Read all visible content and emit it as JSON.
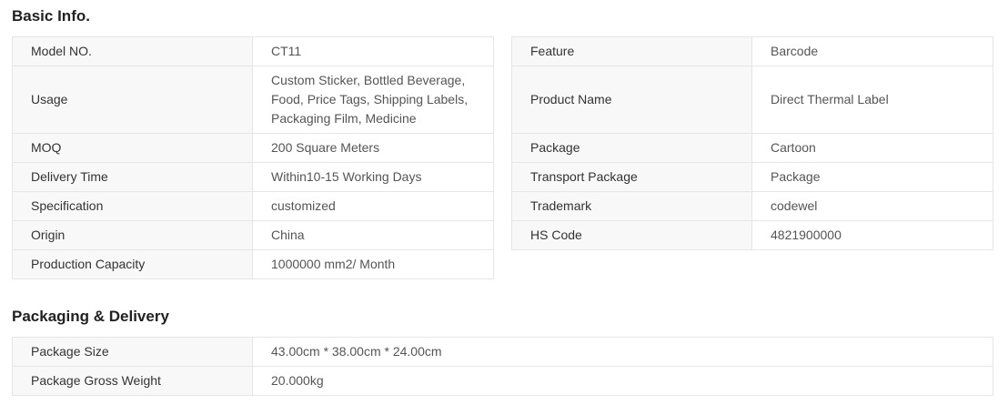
{
  "basic_info": {
    "title": "Basic Info.",
    "left_table": [
      {
        "key": "Model NO.",
        "value": "CT11"
      },
      {
        "key": "Usage",
        "value": "Custom Sticker, Bottled Beverage, Food, Price Tags, Shipping Labels, Packaging Film, Medicine"
      },
      {
        "key": "MOQ",
        "value": "200 Square Meters"
      },
      {
        "key": "Delivery Time",
        "value": "Within10-15 Working Days"
      },
      {
        "key": "Specification",
        "value": "customized"
      },
      {
        "key": "Origin",
        "value": "China"
      },
      {
        "key": "Production Capacity",
        "value": "1000000 mm2/ Month"
      }
    ],
    "right_table": [
      {
        "key": "Feature",
        "value": "Barcode"
      },
      {
        "key": "Product Name",
        "value": "Direct Thermal Label"
      },
      {
        "key": "Package",
        "value": "Cartoon"
      },
      {
        "key": "Transport Package",
        "value": "Package"
      },
      {
        "key": "Trademark",
        "value": "codewel"
      },
      {
        "key": "HS Code",
        "value": "4821900000"
      }
    ]
  },
  "packaging_delivery": {
    "title": "Packaging & Delivery",
    "rows": [
      {
        "key": "Package Size",
        "value": "43.00cm * 38.00cm * 24.00cm"
      },
      {
        "key": "Package Gross Weight",
        "value": "20.000kg"
      }
    ]
  },
  "colors": {
    "key_background": "#f8f8f8",
    "border": "#e6e6e6",
    "value_text": "#555555",
    "heading_text": "#222222"
  }
}
